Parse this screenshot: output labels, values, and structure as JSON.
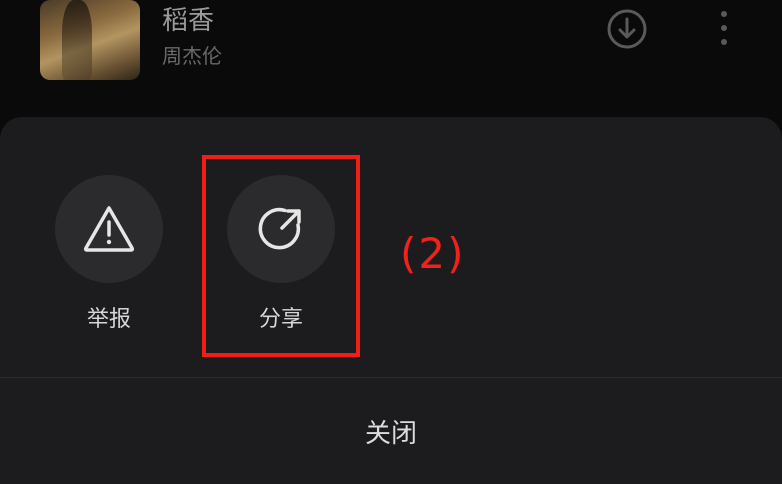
{
  "song_list": [
    {
      "title": "稻香",
      "artist": "周杰伦",
      "icons": [
        "download-icon",
        "more-vertical-icon"
      ]
    },
    {
      "title": "",
      "artist": ""
    }
  ],
  "action_sheet": {
    "actions": [
      {
        "label": "举报",
        "icon": "warning-triangle-icon"
      },
      {
        "label": "分享",
        "icon": "share-arrow-icon"
      }
    ],
    "close_label": "关闭"
  },
  "annotation": {
    "label": "(2)",
    "color": "#f0221a"
  },
  "colors": {
    "sheet_bg": "#1c1c1e",
    "button_bg": "#2b2b2d",
    "highlight": "#f11d17"
  }
}
